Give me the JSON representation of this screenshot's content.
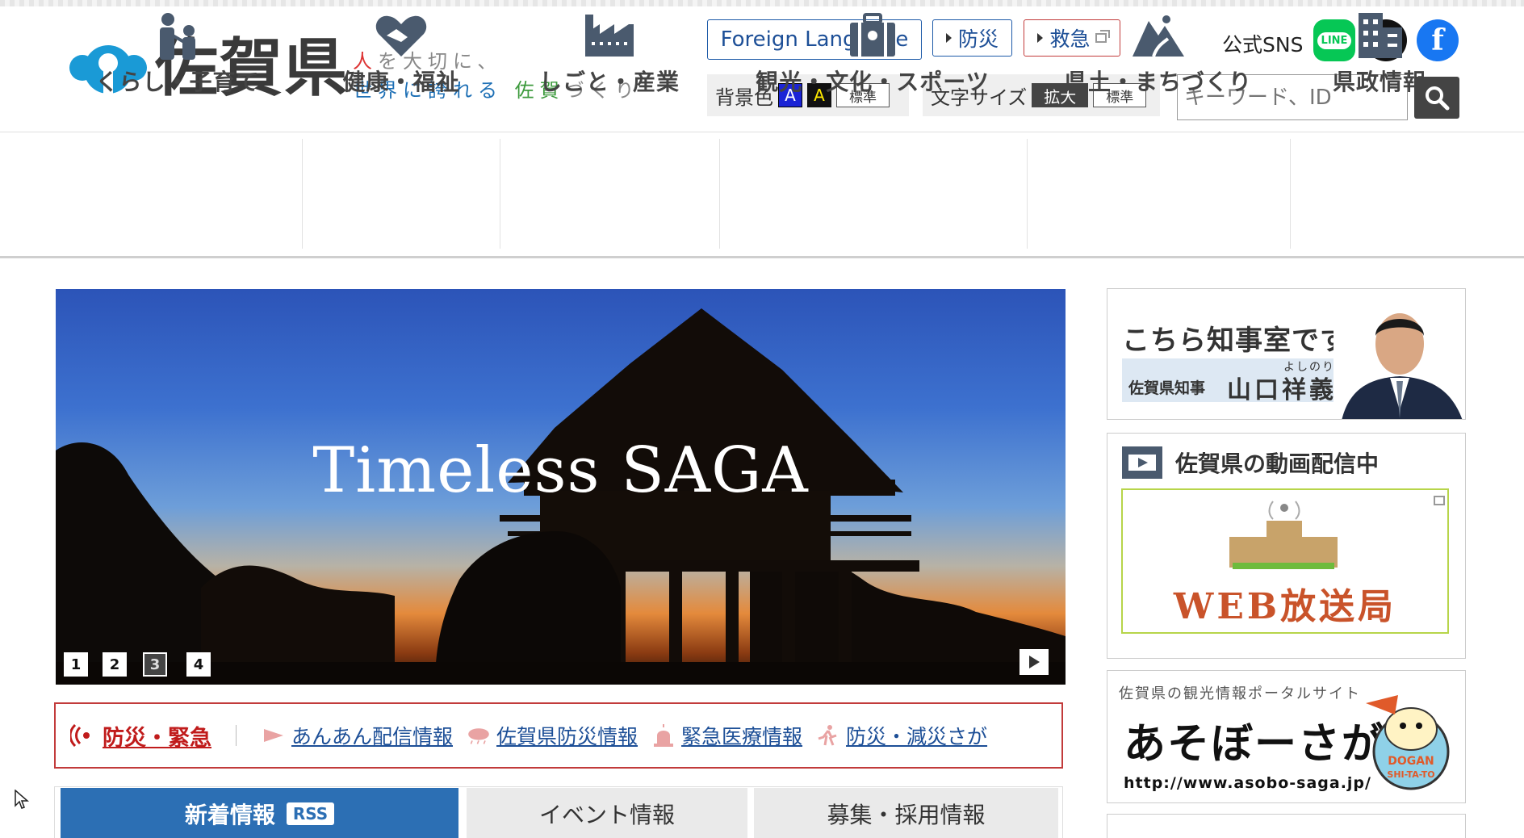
{
  "header": {
    "site_name": "佐賀県",
    "tagline_line1": [
      "人",
      "を大切に、"
    ],
    "tagline_line2": [
      "世界",
      "に誇れる",
      "佐賀",
      "づくり"
    ],
    "foreign_language": "Foreign Language",
    "bousai": "防災",
    "kyukyu": "救急",
    "sns_label": "公式SNS",
    "sns": {
      "line": "LINE",
      "x": "X",
      "facebook": "f"
    },
    "bg_color_label": "背景色",
    "bg_options": [
      "A",
      "A",
      "標準"
    ],
    "font_size_label": "文字サイズ",
    "font_size_options": [
      "拡大",
      "標準"
    ],
    "search_placeholder": "キーワード、ID"
  },
  "gnav": [
    {
      "label": "くらし・子育て",
      "icon": "family-icon"
    },
    {
      "label": "健康・福祉",
      "icon": "heart-handshake-icon"
    },
    {
      "label": "しごと・産業",
      "icon": "factory-icon"
    },
    {
      "label": "観光・文化・スポーツ",
      "icon": "suitcase-icon"
    },
    {
      "label": "県土・まちづくり",
      "icon": "mountain-road-icon"
    },
    {
      "label": "県政情報",
      "icon": "building-icon"
    }
  ],
  "hero": {
    "title": "Timeless SAGA",
    "pages": [
      "1",
      "2",
      "3",
      "4"
    ],
    "active_page": "3"
  },
  "bousai_bar": {
    "title": "防災・緊急",
    "links": [
      {
        "label": "あんあん配信情報",
        "icon": "megaphone-icon"
      },
      {
        "label": "佐賀県防災情報",
        "icon": "rain-cloud-icon"
      },
      {
        "label": "緊急医療情報",
        "icon": "siren-icon"
      },
      {
        "label": "防災・減災さが",
        "icon": "running-person-icon"
      }
    ]
  },
  "tabs": {
    "news": "新着情報",
    "rss": "RSS",
    "event": "イベント情報",
    "recruit": "募集・採用情報"
  },
  "sidebar": {
    "governor": {
      "title": "こちら知事室です",
      "role": "佐賀県知事",
      "name": "山口祥義",
      "ruby": "よしのり"
    },
    "video": {
      "title": "佐賀県の動画配信中",
      "banner_text": "WEB放送局"
    },
    "asobo": {
      "caption": "佐賀県の観光情報ポータルサイト",
      "title": "あそぼーさが",
      "url": "http://www.asobo-saga.jp/",
      "mascot_text": "DOGAN SHI-TA-TO"
    }
  },
  "colors": {
    "primary_blue": "#2c6fb4",
    "emergency_red": "#c23b3b",
    "link_blue": "#1d4f97"
  }
}
